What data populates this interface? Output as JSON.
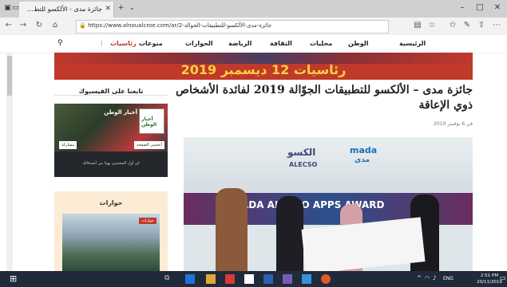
{
  "browser": {
    "tab_title": "جائزة مدى - الألكسو للتط…",
    "url": "https://www.alnoualcroe.com/ar/2-جائزة-مدى-الألكسو-للتطبيقات-الجوالة",
    "title_controls": {
      "min": "–",
      "max": "□",
      "close": "✕"
    }
  },
  "menu": {
    "home": "الرئيسية",
    "nation": "الوطن",
    "local": "محليات",
    "culture": "الثقافة",
    "sports": "الرياضة",
    "interviews": "الحوارات",
    "misc": "منوعات",
    "presidential": "رئاسيات"
  },
  "banner": {
    "text": "رئاسيات 12 ديسمبر 2019"
  },
  "article": {
    "title": "جائزة مدى – الألكسو للتطبيقات الجوّالة 2019 لفائدة الأشخاص ذوي الإعاقة",
    "date": "في 6 نوفمبر 2019"
  },
  "image": {
    "mada": "mada",
    "mada_ar": "مدى",
    "alecso_ar": "الكسو",
    "alecso": "ALECSO",
    "award_text": "MADA ALECSO APPS AWARD"
  },
  "sidebar": {
    "facebook_title": "تابعنا على الفيسبوك",
    "fb_page_name": "أخبار الوطن",
    "fb_like": "أعجبني الصفحة",
    "fb_share": "مشاركة",
    "fb_footer": "كن أول المعجبين بهذا من أصدقائك",
    "interviews_title": "حوارات",
    "interviews_tag": "حوارات"
  },
  "taskbar": {
    "lang": "ENG",
    "time": "2:51 PM",
    "date": "20/11/2019"
  },
  "colors": {
    "banner_red": "#c0392b",
    "banner_yellow": "#f7d23b",
    "taskbar": "#1f2a3a"
  }
}
